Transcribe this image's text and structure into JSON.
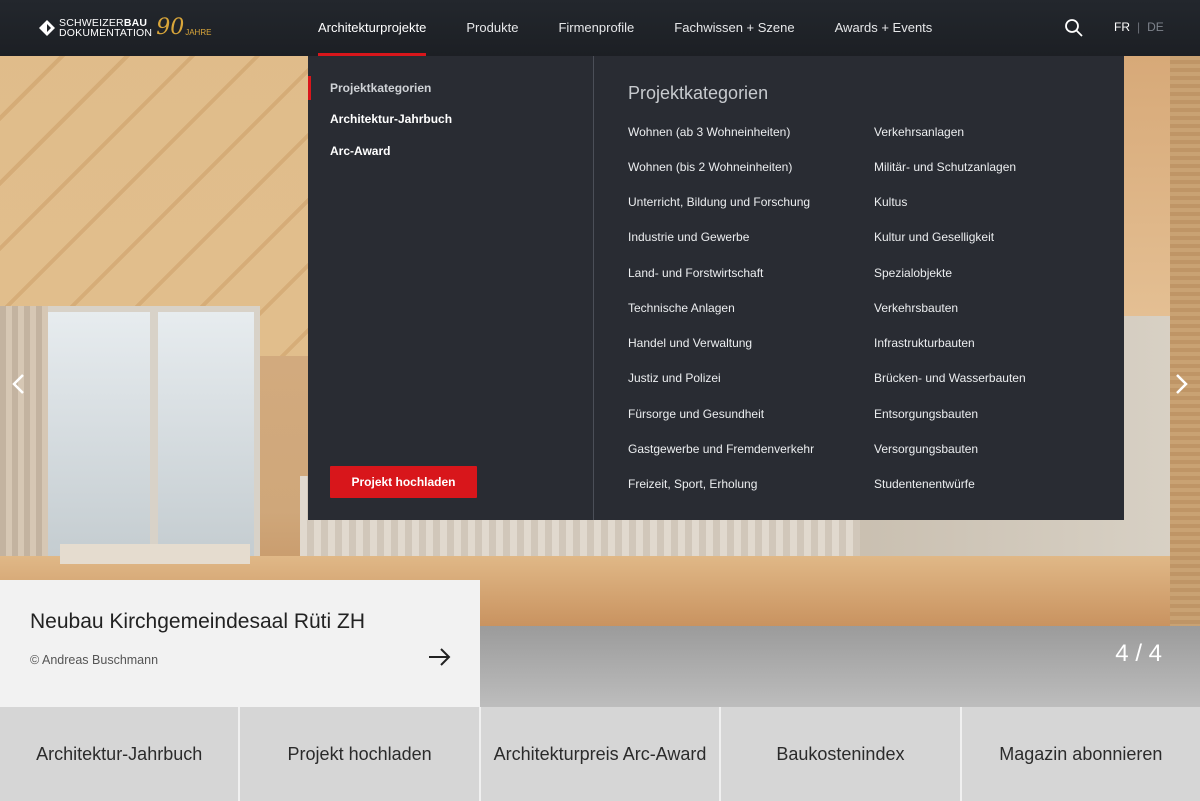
{
  "logo": {
    "line1_light": "SCHWEIZER",
    "line1_bold": "BAU",
    "line2": "DOKUMENTATION",
    "jubilee_number": "90",
    "jubilee_word": "JAHRE",
    "gold_color": "#d9a63a"
  },
  "nav": {
    "items": [
      {
        "label": "Architekturprojekte",
        "active": true
      },
      {
        "label": "Produkte"
      },
      {
        "label": "Firmenprofile"
      },
      {
        "label": "Fachwissen + Szene"
      },
      {
        "label": "Awards + Events"
      }
    ],
    "search_icon": "search-icon",
    "lang_active": "FR",
    "lang_separator": "|",
    "lang_inactive": "DE"
  },
  "dropdown": {
    "left_items": [
      "Projektkategorien",
      "Architektur-Jahrbuch",
      "Arc-Award"
    ],
    "upload_button": "Projekt hochladen",
    "title": "Projektkategorien",
    "col1": [
      "Wohnen (ab 3 Wohneinheiten)",
      "Wohnen (bis 2 Wohneinheiten)",
      "Unterricht, Bildung und Forschung",
      "Industrie und Gewerbe",
      "Land- und Forstwirtschaft",
      "Technische Anlagen",
      "Handel und Verwaltung",
      "Justiz und Polizei",
      "Fürsorge und Gesundheit",
      "Gastgewerbe und Fremdenverkehr",
      "Freizeit, Sport, Erholung"
    ],
    "col2": [
      "Verkehrsanlagen",
      "Militär- und Schutzanlagen",
      "Kultus",
      "Kultur und Geselligkeit",
      "Spezialobjekte",
      "Verkehrsbauten",
      "Infrastrukturbauten",
      "Brücken- und Wasserbauten",
      "Entsorgungsbauten",
      "Versorgungsbauten",
      "Studentenentwürfe"
    ]
  },
  "slide": {
    "title": "Neubau Kirchgemeindesaal Rüti ZH",
    "credit": "© Andreas Buschmann",
    "counter": "4 / 4"
  },
  "tiles": [
    "Architektur-Jahrbuch",
    "Projekt hochladen",
    "Architekturpreis Arc-Award",
    "Baukostenindex",
    "Magazin abonnieren"
  ],
  "colors": {
    "accent": "#d8161b",
    "header_bg": "#202328",
    "dropdown_bg": "#292c33"
  }
}
